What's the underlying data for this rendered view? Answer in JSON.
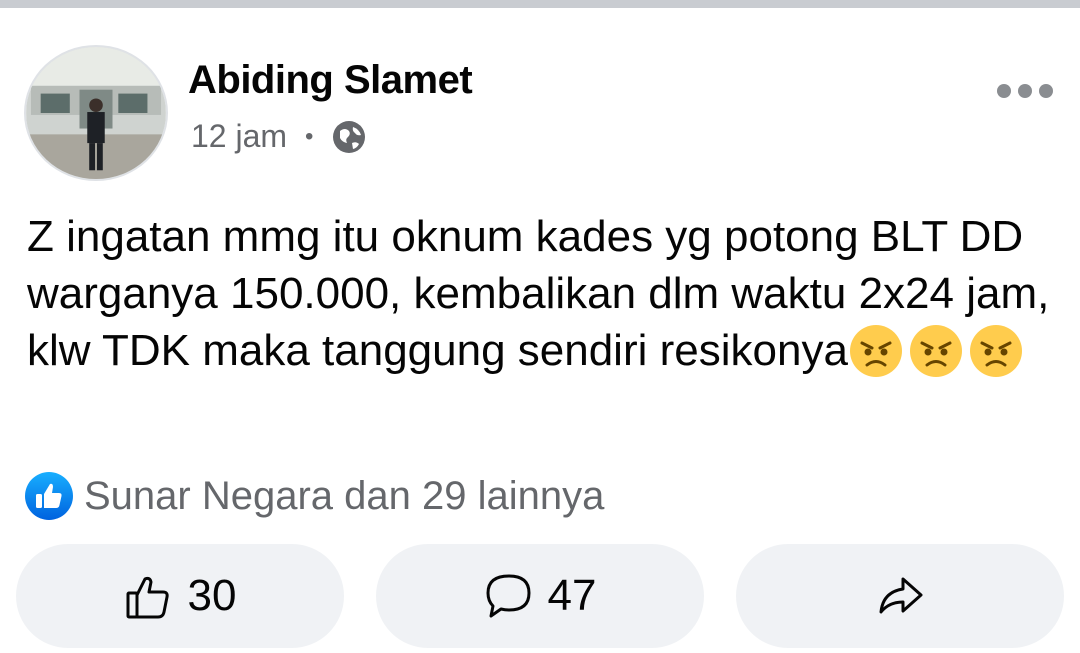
{
  "post": {
    "author": "Abiding Slamet",
    "time": "12 jam",
    "separator": "•",
    "privacy_icon": "globe-icon",
    "text": "Z ingatan mmg itu oknum kades yg potong BLT DD warganya 150.000, kembalikan dlm waktu 2x24 jam, klw TDK maka tanggung sendiri resikonya",
    "emoji": [
      "angry-face-icon",
      "angry-face-icon",
      "angry-face-icon"
    ],
    "reactions_text": "Sunar Negara dan 29 lainnya",
    "actions": {
      "like_count": "30",
      "comment_count": "47",
      "share_icon": "share-arrow-icon"
    }
  },
  "colors": {
    "accent": "#1877f2",
    "secondary_text": "#65676b",
    "button_bg": "#f0f2f5",
    "emoji_face": "#ffcc4d"
  }
}
